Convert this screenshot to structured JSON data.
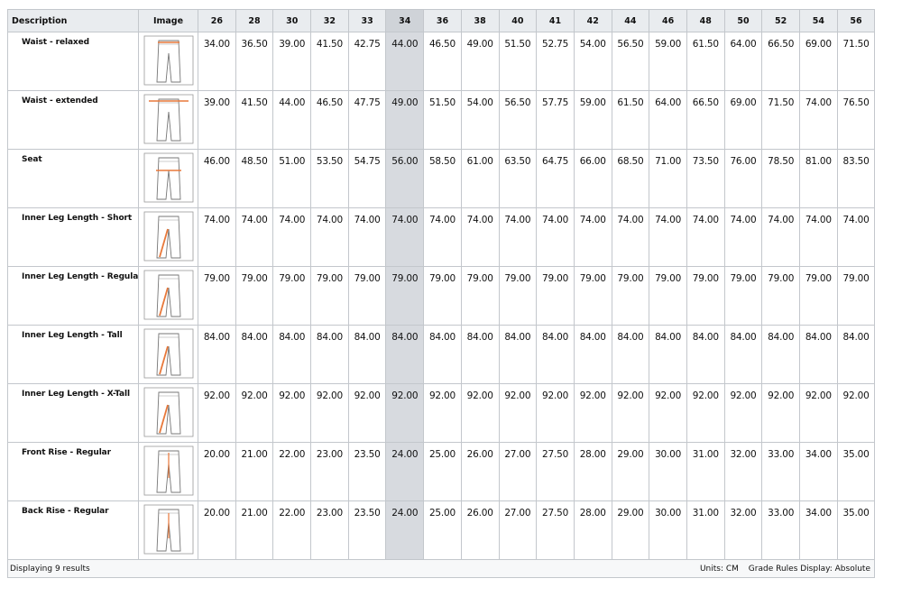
{
  "table": {
    "headers": {
      "description": "Description",
      "image": "Image",
      "sizes": [
        "26",
        "28",
        "30",
        "32",
        "33",
        "34",
        "36",
        "38",
        "40",
        "41",
        "42",
        "44",
        "46",
        "48",
        "50",
        "52",
        "54",
        "56"
      ]
    },
    "highlight_size_index": 5,
    "rows": [
      {
        "label": "Waist - relaxed",
        "icon": "pants-waist-relaxed-icon",
        "values": [
          "34.00",
          "36.50",
          "39.00",
          "41.50",
          "42.75",
          "44.00",
          "46.50",
          "49.00",
          "51.50",
          "52.75",
          "54.00",
          "56.50",
          "59.00",
          "61.50",
          "64.00",
          "66.50",
          "69.00",
          "71.50"
        ]
      },
      {
        "label": "Waist - extended",
        "icon": "pants-waist-extended-icon",
        "values": [
          "39.00",
          "41.50",
          "44.00",
          "46.50",
          "47.75",
          "49.00",
          "51.50",
          "54.00",
          "56.50",
          "57.75",
          "59.00",
          "61.50",
          "64.00",
          "66.50",
          "69.00",
          "71.50",
          "74.00",
          "76.50"
        ]
      },
      {
        "label": "Seat",
        "icon": "pants-seat-icon",
        "values": [
          "46.00",
          "48.50",
          "51.00",
          "53.50",
          "54.75",
          "56.00",
          "58.50",
          "61.00",
          "63.50",
          "64.75",
          "66.00",
          "68.50",
          "71.00",
          "73.50",
          "76.00",
          "78.50",
          "81.00",
          "83.50"
        ]
      },
      {
        "label": "Inner Leg Length - Short",
        "icon": "pants-inner-leg-icon",
        "values": [
          "74.00",
          "74.00",
          "74.00",
          "74.00",
          "74.00",
          "74.00",
          "74.00",
          "74.00",
          "74.00",
          "74.00",
          "74.00",
          "74.00",
          "74.00",
          "74.00",
          "74.00",
          "74.00",
          "74.00",
          "74.00"
        ]
      },
      {
        "label": "Inner Leg Length - Regular",
        "icon": "pants-inner-leg-icon",
        "values": [
          "79.00",
          "79.00",
          "79.00",
          "79.00",
          "79.00",
          "79.00",
          "79.00",
          "79.00",
          "79.00",
          "79.00",
          "79.00",
          "79.00",
          "79.00",
          "79.00",
          "79.00",
          "79.00",
          "79.00",
          "79.00"
        ]
      },
      {
        "label": "Inner Leg Length - Tall",
        "icon": "pants-inner-leg-icon",
        "values": [
          "84.00",
          "84.00",
          "84.00",
          "84.00",
          "84.00",
          "84.00",
          "84.00",
          "84.00",
          "84.00",
          "84.00",
          "84.00",
          "84.00",
          "84.00",
          "84.00",
          "84.00",
          "84.00",
          "84.00",
          "84.00"
        ]
      },
      {
        "label": "Inner Leg Length - X-Tall",
        "icon": "pants-inner-leg-icon",
        "values": [
          "92.00",
          "92.00",
          "92.00",
          "92.00",
          "92.00",
          "92.00",
          "92.00",
          "92.00",
          "92.00",
          "92.00",
          "92.00",
          "92.00",
          "92.00",
          "92.00",
          "92.00",
          "92.00",
          "92.00",
          "92.00"
        ]
      },
      {
        "label": "Front Rise - Regular",
        "icon": "pants-front-rise-icon",
        "values": [
          "20.00",
          "21.00",
          "22.00",
          "23.00",
          "23.50",
          "24.00",
          "25.00",
          "26.00",
          "27.00",
          "27.50",
          "28.00",
          "29.00",
          "30.00",
          "31.00",
          "32.00",
          "33.00",
          "34.00",
          "35.00"
        ]
      },
      {
        "label": "Back Rise - Regular",
        "icon": "pants-back-rise-icon",
        "values": [
          "20.00",
          "21.00",
          "22.00",
          "23.00",
          "23.50",
          "24.00",
          "25.00",
          "26.00",
          "27.00",
          "27.50",
          "28.00",
          "29.00",
          "30.00",
          "31.00",
          "32.00",
          "33.00",
          "34.00",
          "35.00"
        ]
      }
    ]
  },
  "footer": {
    "results_text": "Displaying 9 results",
    "units_text": "Units: CM",
    "grade_rules_text": "Grade Rules Display: Absolute"
  },
  "colors": {
    "header_bg": "#e9ecef",
    "highlight_bg": "#d7dadf",
    "border": "#c3c7cc",
    "measure_accent": "#e8783a"
  }
}
